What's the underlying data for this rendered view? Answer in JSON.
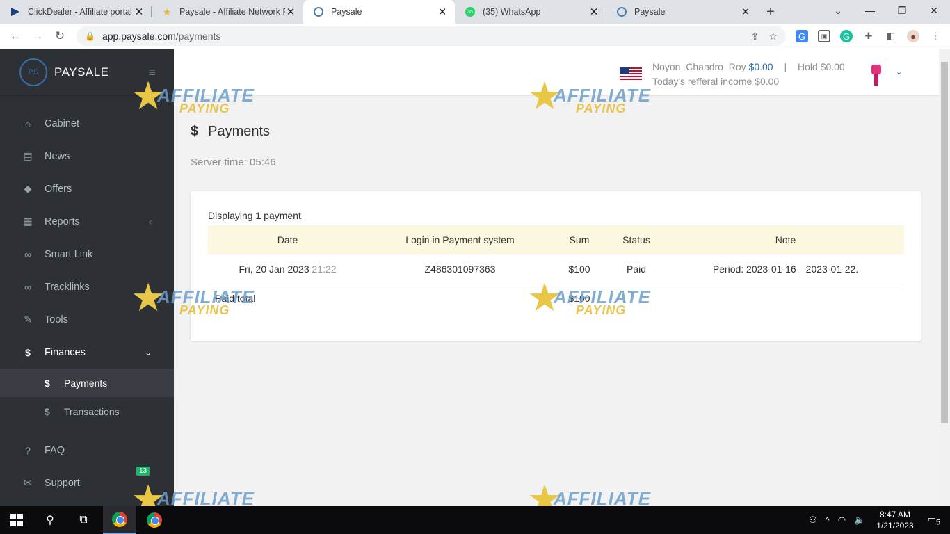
{
  "browser": {
    "tabs": [
      {
        "title": "ClickDealer - Affiliate portal",
        "active": false
      },
      {
        "title": "Paysale - Affiliate Network Re",
        "active": false
      },
      {
        "title": "Paysale",
        "active": true
      },
      {
        "title": "(35) WhatsApp",
        "active": false
      },
      {
        "title": "Paysale",
        "active": false
      }
    ],
    "url_host": "app.paysale.com",
    "url_path": "/payments",
    "whatsapp_count": "35"
  },
  "sidebar": {
    "brand": "PAYSALE",
    "logo_text": "PS",
    "items": [
      {
        "label": "Cabinet",
        "icon": "home-icon"
      },
      {
        "label": "News",
        "icon": "newspaper-icon"
      },
      {
        "label": "Offers",
        "icon": "tag-icon"
      },
      {
        "label": "Reports",
        "icon": "table-icon"
      },
      {
        "label": "Smart Link",
        "icon": "link-icon"
      },
      {
        "label": "Tracklinks",
        "icon": "link-icon"
      },
      {
        "label": "Tools",
        "icon": "wrench-icon"
      },
      {
        "label": "Finances",
        "icon": "dollar-icon"
      },
      {
        "label": "FAQ",
        "icon": "question-icon"
      },
      {
        "label": "Support",
        "icon": "ticket-icon"
      }
    ],
    "sub_items": [
      {
        "label": "Payments",
        "active": true
      },
      {
        "label": "Transactions",
        "active": false
      }
    ],
    "support_badge": "13"
  },
  "header": {
    "username": "Noyon_Chandro_Roy",
    "balance": "$0.00",
    "hold_label": "Hold",
    "hold_value": "$0.00",
    "referral_label": "Today's refferal income",
    "referral_value": "$0.00"
  },
  "page": {
    "title": "Payments",
    "server_time": "Server time: 05:46",
    "display_prefix": "Displaying",
    "display_count": "1",
    "display_suffix": "payment"
  },
  "table": {
    "headers": [
      "Date",
      "Login in Payment system",
      "Sum",
      "Status",
      "Note"
    ],
    "rows": [
      {
        "date": "Fri, 20 Jan 2023",
        "time": "21:22",
        "login": "Z486301097363",
        "sum": "$100",
        "status": "Paid",
        "note": "Period: 2023-01-16—2023-01-22."
      }
    ],
    "total_label": "Paid total",
    "total_value": "$100"
  },
  "watermark": {
    "line1": "AFFILIATE",
    "line2": "PAYING"
  },
  "taskbar": {
    "time": "8:47 AM",
    "date": "1/21/2023",
    "notifications": "5"
  },
  "colors": {
    "sidebar_bg": "#2d3136",
    "accent_blue": "#2b6cb0",
    "table_header_bg": "#fcf7df",
    "badge_green": "#1fb36b"
  }
}
